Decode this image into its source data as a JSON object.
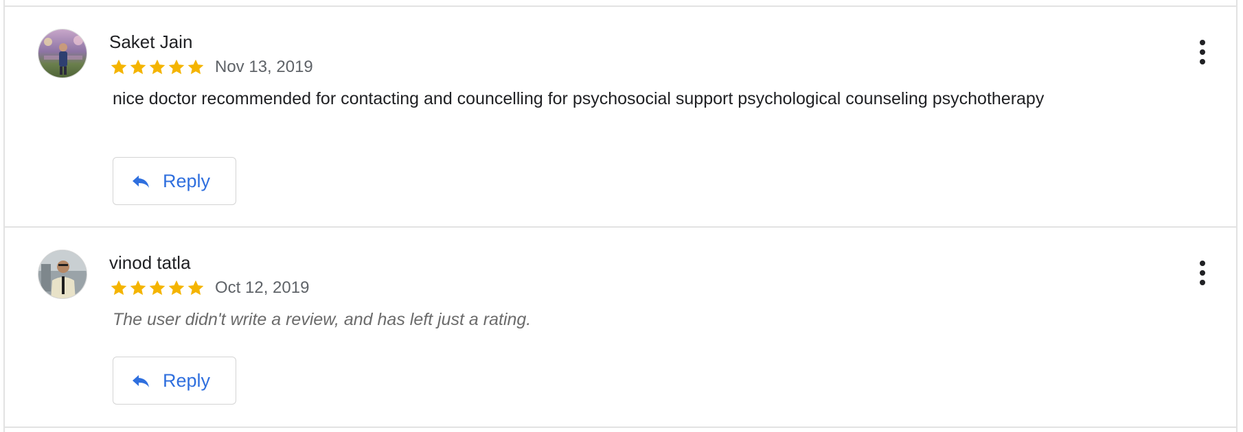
{
  "reviews": [
    {
      "author": "Saket Jain",
      "avatar_icon": "user-avatar-icon",
      "rating": 5,
      "max_rating": 5,
      "date": "Nov 13, 2019",
      "text": "nice doctor recommended for contacting and councelling for psychosocial support psychological counseling psychotherapy",
      "reply_label": "Reply"
    },
    {
      "author": "vinod tatla",
      "avatar_icon": "user-avatar-icon",
      "rating": 5,
      "max_rating": 5,
      "date": "Oct 12, 2019",
      "text": "The user didn't write a review, and has left just a rating.",
      "reply_label": "Reply"
    }
  ],
  "icons": {
    "star": "star-icon",
    "reply": "reply-arrow-icon",
    "more": "more-vertical-icon"
  },
  "colors": {
    "star": "#f4b400",
    "accent": "#2f6fde",
    "border": "#e2e2e2",
    "text": "#202124",
    "muted": "#5f6368"
  }
}
